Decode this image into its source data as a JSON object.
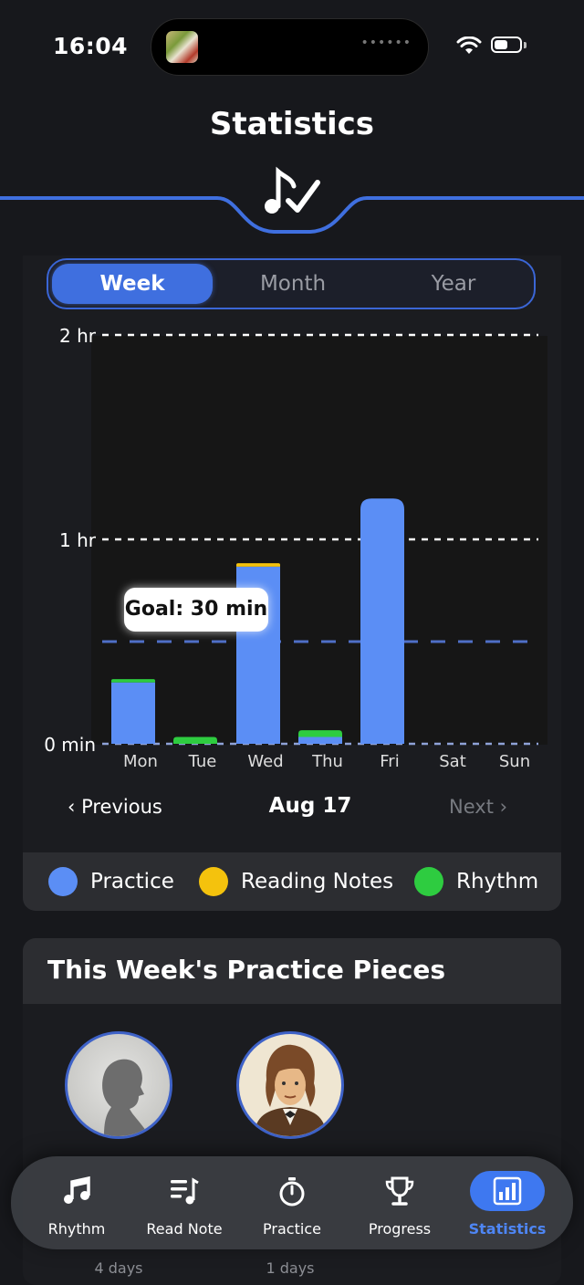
{
  "status_bar": {
    "time": "16:04"
  },
  "header": {
    "title": "Statistics"
  },
  "period_tabs": [
    {
      "label": "Week",
      "active": true
    },
    {
      "label": "Month",
      "active": false
    },
    {
      "label": "Year",
      "active": false
    }
  ],
  "chart_data": {
    "type": "bar",
    "stacked": true,
    "categories": [
      "Mon",
      "Tue",
      "Wed",
      "Thu",
      "Fri",
      "Sat",
      "Sun"
    ],
    "series": [
      {
        "name": "Practice",
        "color": "#5b8ef5",
        "values": [
          18,
          0,
          52,
          2,
          72,
          0,
          0
        ]
      },
      {
        "name": "Reading Notes",
        "color": "#f4c20d",
        "values": [
          0,
          0,
          1,
          0,
          0,
          0,
          0
        ]
      },
      {
        "name": "Rhythm",
        "color": "#2ecc40",
        "values": [
          1,
          2,
          0,
          2,
          0,
          0,
          0
        ]
      }
    ],
    "y_ticks": [
      {
        "value": 0,
        "label": "0 min"
      },
      {
        "value": 60,
        "label": "1 hr"
      },
      {
        "value": 120,
        "label": "2 hr"
      }
    ],
    "ylim": [
      0,
      120
    ],
    "goal": {
      "value": 30,
      "label": "Goal: 30 min",
      "color": "#4f6fc7"
    }
  },
  "navigation": {
    "previous": "Previous",
    "date": "Aug 17",
    "next": "Next"
  },
  "legend": [
    {
      "label": "Practice",
      "color": "#5b8ef5"
    },
    {
      "label": "Reading Notes",
      "color": "#f4c20d"
    },
    {
      "label": "Rhythm",
      "color": "#2ecc40"
    }
  ],
  "pieces": {
    "title": "This Week's Practice Pieces",
    "items": [
      {
        "days": "4 days",
        "portrait": "silhouette"
      },
      {
        "days": "1 days",
        "portrait": "composer"
      }
    ]
  },
  "tabbar": [
    {
      "label": "Rhythm",
      "icon": "music-note-icon",
      "active": false
    },
    {
      "label": "Read Note",
      "icon": "music-list-icon",
      "active": false
    },
    {
      "label": "Practice",
      "icon": "stopwatch-icon",
      "active": false
    },
    {
      "label": "Progress",
      "icon": "trophy-icon",
      "active": false
    },
    {
      "label": "Statistics",
      "icon": "bar-chart-icon",
      "active": true
    }
  ]
}
